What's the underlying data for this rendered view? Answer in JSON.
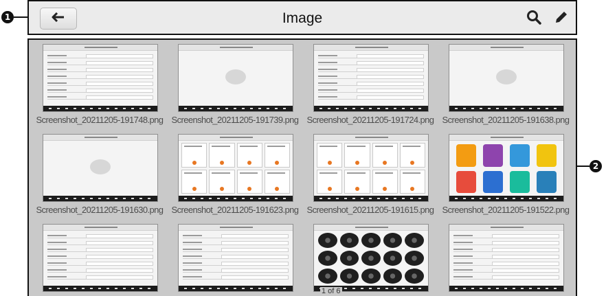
{
  "callouts": {
    "header_marker": "1",
    "content_marker": "2"
  },
  "header": {
    "title": "Image",
    "back_icon": "arrow-left-icon",
    "search_icon": "search-icon",
    "edit_icon": "pencil-icon"
  },
  "images": [
    {
      "filename": "Screenshot_20211205-191748.png",
      "preview": "form"
    },
    {
      "filename": "Screenshot_20211205-191739.png",
      "preview": "empty-list"
    },
    {
      "filename": "Screenshot_20211205-191724.png",
      "preview": "form"
    },
    {
      "filename": "Screenshot_20211205-191638.png",
      "preview": "empty-list"
    },
    {
      "filename": "Screenshot_20211205-191630.png",
      "preview": "empty-list"
    },
    {
      "filename": "Screenshot_20211205-191623.png",
      "preview": "cards"
    },
    {
      "filename": "Screenshot_20211205-191615.png",
      "preview": "cards"
    },
    {
      "filename": "Screenshot_20211205-191522.png",
      "preview": "app-grid"
    },
    {
      "filename": "",
      "preview": "list"
    },
    {
      "filename": "",
      "preview": "table"
    },
    {
      "filename": "",
      "preview": "tire-grid"
    },
    {
      "filename": "",
      "preview": "list"
    }
  ],
  "app_tile_colors": [
    "#f39c12",
    "#8e44ad",
    "#3498db",
    "#f1c40f",
    "#e74c3c",
    "#2c6fd1",
    "#1abc9c",
    "#2980b9"
  ],
  "pager": {
    "label": "1 of 6"
  },
  "colors": {
    "content_bg": "#c9c9c9",
    "header_bg": "#ebebeb",
    "filename_text": "#4d4d4d"
  }
}
